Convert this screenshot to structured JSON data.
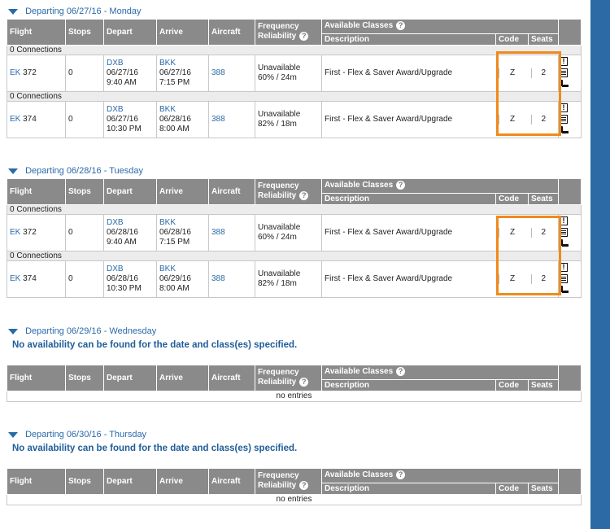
{
  "headers": {
    "flight": "Flight",
    "stops": "Stops",
    "depart": "Depart",
    "arrive": "Arrive",
    "aircraft": "Aircraft",
    "frequency": "Frequency",
    "reliability": "Reliability",
    "available_classes": "Available Classes",
    "description": "Description",
    "code": "Code",
    "seats": "Seats"
  },
  "connections_label": "0 Connections",
  "no_entries": "no entries",
  "no_availability": "No availability can be found for the date and class(es) specified.",
  "accent_color": "#2a6aa8",
  "highlight_color": "#f08a1c",
  "sections": [
    {
      "title": "Departing 06/27/16 - Monday",
      "flights": [
        {
          "flight_prefix": "EK",
          "flight_no": "372",
          "stops": "0",
          "dep_airport": "DXB",
          "dep_date": "06/27/16",
          "dep_time": "9:40 AM",
          "arr_airport": "BKK",
          "arr_date": "06/27/16",
          "arr_time": "7:15 PM",
          "aircraft": "388",
          "freq1": "Unavailable",
          "freq2": "60% / 24m",
          "description": "First - Flex & Saver Award/Upgrade",
          "code": "Z",
          "seats": "2"
        },
        {
          "flight_prefix": "EK",
          "flight_no": "374",
          "stops": "0",
          "dep_airport": "DXB",
          "dep_date": "06/27/16",
          "dep_time": "10:30 PM",
          "arr_airport": "BKK",
          "arr_date": "06/28/16",
          "arr_time": "8:00 AM",
          "aircraft": "388",
          "freq1": "Unavailable",
          "freq2": "82% / 18m",
          "description": "First - Flex & Saver Award/Upgrade",
          "code": "Z",
          "seats": "2"
        }
      ]
    },
    {
      "title": "Departing 06/28/16 - Tuesday",
      "flights": [
        {
          "flight_prefix": "EK",
          "flight_no": "372",
          "stops": "0",
          "dep_airport": "DXB",
          "dep_date": "06/28/16",
          "dep_time": "9:40 AM",
          "arr_airport": "BKK",
          "arr_date": "06/28/16",
          "arr_time": "7:15 PM",
          "aircraft": "388",
          "freq1": "Unavailable",
          "freq2": "60% / 24m",
          "description": "First - Flex & Saver Award/Upgrade",
          "code": "Z",
          "seats": "2"
        },
        {
          "flight_prefix": "EK",
          "flight_no": "374",
          "stops": "0",
          "dep_airport": "DXB",
          "dep_date": "06/28/16",
          "dep_time": "10:30 PM",
          "arr_airport": "BKK",
          "arr_date": "06/29/16",
          "arr_time": "8:00 AM",
          "aircraft": "388",
          "freq1": "Unavailable",
          "freq2": "82% / 18m",
          "description": "First - Flex & Saver Award/Upgrade",
          "code": "Z",
          "seats": "2"
        }
      ]
    },
    {
      "title": "Departing 06/29/16 - Wednesday",
      "flights": []
    },
    {
      "title": "Departing 06/30/16 - Thursday",
      "flights": []
    }
  ]
}
